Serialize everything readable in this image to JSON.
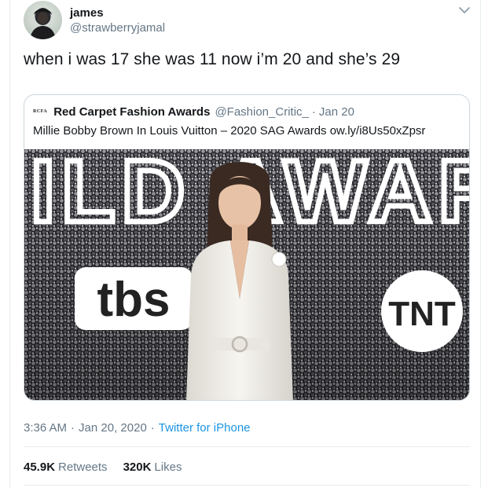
{
  "author": {
    "name": "james",
    "handle": "@strawberryjamal"
  },
  "tweet": {
    "text": "when i was 17 she was 11 now i’m 20 and she’s 29",
    "time": "3:36 AM",
    "date": "Jan 20, 2020",
    "source": "Twitter for iPhone",
    "separator": "·"
  },
  "quoted_tweet": {
    "avatar_text": "RCFA",
    "name": "Red Carpet Fashion Awards",
    "handle": "@Fashion_Critic_",
    "separator": "·",
    "date": "Jan 20",
    "text": "Millie Bobby Brown In Louis Vuitton – 2020 SAG Awards ow.ly/i8Us50xZpsr",
    "image": {
      "backdrop_text": "ILD AWAR",
      "logo_left": "tbs",
      "logo_right": "TNT"
    }
  },
  "stats": {
    "retweets_count": "45.9K",
    "retweets_label": "Retweets",
    "likes_count": "320K",
    "likes_label": "Likes"
  },
  "icons": {
    "menu": "chevron-down-icon"
  },
  "colors": {
    "link": "#1b95e0",
    "secondary_text": "#657786",
    "border": "#ccd6dd"
  }
}
